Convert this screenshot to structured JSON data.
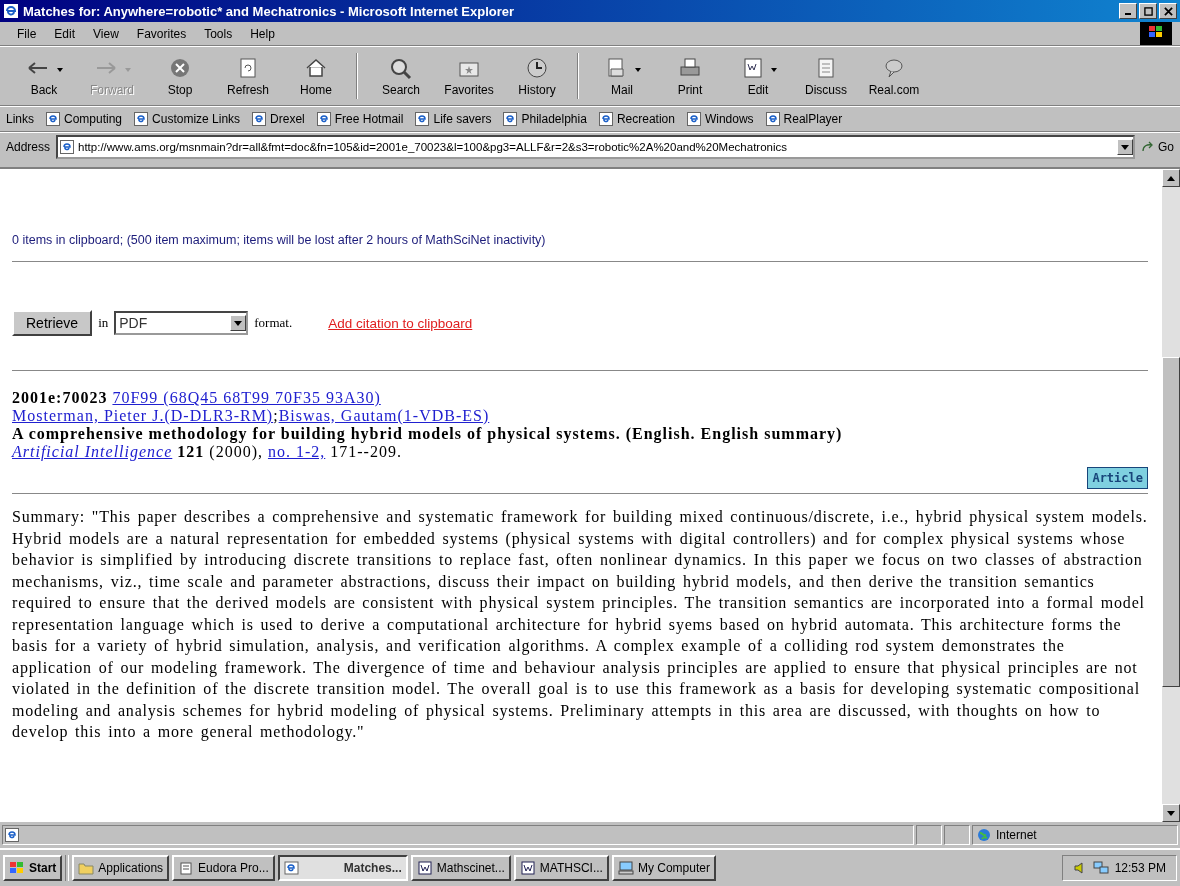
{
  "window": {
    "title": "Matches for: Anywhere=robotic* and Mechatronics - Microsoft Internet Explorer"
  },
  "menu": [
    "File",
    "Edit",
    "View",
    "Favorites",
    "Tools",
    "Help"
  ],
  "toolbar": [
    {
      "kind": "back",
      "label": "Back",
      "disabled": false,
      "dropdown": true
    },
    {
      "kind": "forward",
      "label": "Forward",
      "disabled": true,
      "dropdown": true
    },
    {
      "kind": "stop",
      "label": "Stop",
      "disabled": false,
      "dropdown": false
    },
    {
      "kind": "refresh",
      "label": "Refresh",
      "disabled": false,
      "dropdown": false
    },
    {
      "kind": "home",
      "label": "Home",
      "disabled": false,
      "dropdown": false,
      "separator": true
    },
    {
      "kind": "search",
      "label": "Search",
      "disabled": false,
      "dropdown": false
    },
    {
      "kind": "favorites",
      "label": "Favorites",
      "disabled": false,
      "dropdown": false
    },
    {
      "kind": "history",
      "label": "History",
      "disabled": false,
      "dropdown": false,
      "separator": true
    },
    {
      "kind": "mail",
      "label": "Mail",
      "disabled": false,
      "dropdown": true
    },
    {
      "kind": "print",
      "label": "Print",
      "disabled": false,
      "dropdown": false
    },
    {
      "kind": "edit",
      "label": "Edit",
      "disabled": false,
      "dropdown": true
    },
    {
      "kind": "discuss",
      "label": "Discuss",
      "disabled": false,
      "dropdown": false
    },
    {
      "kind": "chat",
      "label": "Real.com",
      "disabled": false,
      "dropdown": false
    }
  ],
  "links": {
    "label": "Links",
    "items": [
      "Computing",
      "Customize Links",
      "Drexel",
      "Free Hotmail",
      "Life savers",
      "Philadelphia",
      "Recreation",
      "Windows",
      "RealPlayer"
    ]
  },
  "address": {
    "label": "Address",
    "url": "http://www.ams.org/msnmain?dr=all&fmt=doc&fn=105&id=2001e_70023&l=100&pg3=ALLF&r=2&s3=robotic%2A%20and%20Mechatronics",
    "go": "Go"
  },
  "page": {
    "clipboard_note": "0 items in clipboard; (500 item maximum; items will be lost after 2 hours of MathSciNet inactivity)",
    "retrieve": "Retrieve",
    "in": "in",
    "format": "PDF",
    "format_suffix": "format.",
    "add_citation": "Add citation to clipboard",
    "record": {
      "id": "2001e:70023",
      "classification": "70F99 (68Q45 68T99 70F35 93A30)",
      "authors": [
        "Mosterman, Pieter J.(D-DLR3-RM)",
        "Biswas, Gautam(1-VDB-ES)"
      ],
      "author_separator": ";",
      "title": "A comprehensive methodology for building hybrid models of physical systems. (English. English summary)",
      "journal": "Artificial Intelligence",
      "volume": "121",
      "year": "(2000),",
      "issue": "no. 1-2,",
      "pages": "171--209.",
      "article": "Article"
    },
    "summary": "Summary: \"This paper describes a comprehensive and systematic framework for building mixed continuous/discrete, i.e., hybrid physical system models. Hybrid models are a natural representation for embedded systems (physical systems with digital controllers) and for complex physical systems whose behavior is simplified by introducing discrete transitions to replace fast, often nonlinear dynamics. In this paper we focus on two classes of abstraction mechanisms, viz., time scale and parameter abstractions, discuss their impact on building hybrid models, and then derive the transition semantics required to ensure that the derived models are consistent with physical system principles. The transition semantics are incorporated into a formal model representation language which is used to derive a computational architecture for hybrid syems based on hybrid automata. This architecture forms the basis for a variety of hybrid simulation, analysis, and verification algorithms. A complex example of a colliding rod system demonstrates the application of our modeling framework. The divergence of time and behaviour analysis principles are applied to ensure that physical principles are not violated in the definition of the discrete transition model. The overall goal is to use this framework as a basis for developing systematic compositional modeling and analysis schemes for hybrid modeling of physical systems. Preliminary attempts in this area are discussed, with thoughts on how to develop this into a more general methodology.\""
  },
  "status_bar": {
    "zone": "Internet"
  },
  "taskbar": {
    "start": "Start",
    "tasks": [
      {
        "kind": "folder",
        "label": "Applications",
        "selected": false
      },
      {
        "kind": "eudora",
        "label": "Eudora Pro...",
        "selected": false
      },
      {
        "kind": "ie",
        "label": "Matches...",
        "selected": true
      },
      {
        "kind": "word",
        "label": "Mathscinet...",
        "selected": false
      },
      {
        "kind": "word",
        "label": "MATHSCI...",
        "selected": false
      },
      {
        "kind": "computer",
        "label": "My Computer",
        "selected": false
      }
    ],
    "clock": "12:53 PM"
  }
}
